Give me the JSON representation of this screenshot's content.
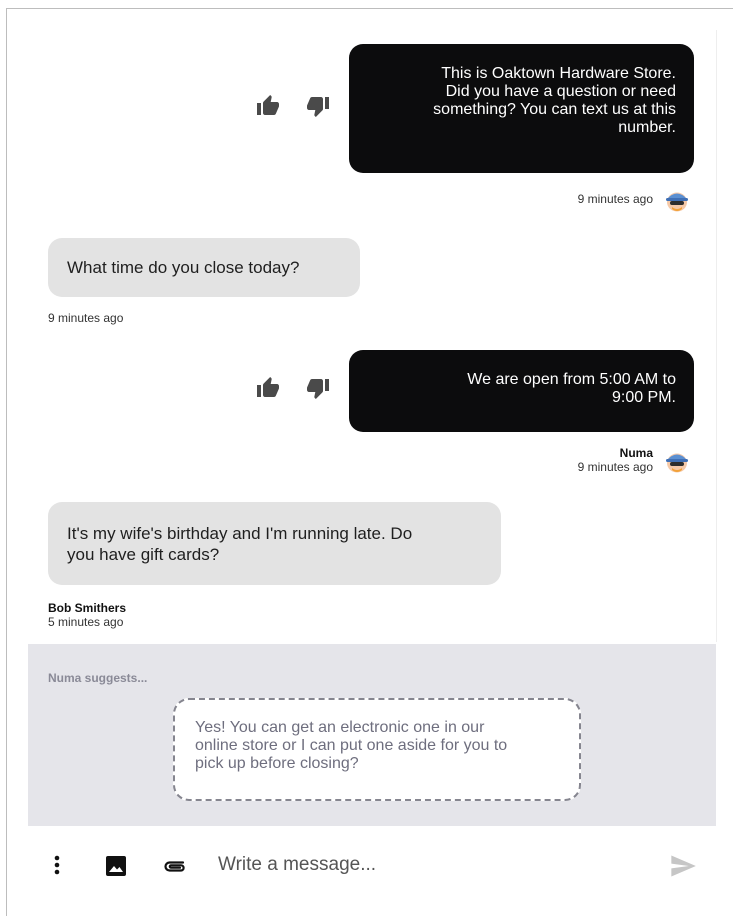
{
  "conversation": {
    "messages": [
      {
        "direction": "outgoing",
        "lines": [
          "This is Oaktown Hardware Store.",
          "Did you have a question or need",
          "something? You can text us at this",
          "number."
        ],
        "sender": "",
        "time": "9 minutes ago"
      },
      {
        "direction": "incoming",
        "lines": [
          "What time do you close today?"
        ],
        "sender": "",
        "time": "9 minutes ago"
      },
      {
        "direction": "outgoing",
        "lines": [
          "We are open from 5:00 AM to",
          "9:00 PM."
        ],
        "sender": "Numa",
        "time": "9 minutes ago"
      },
      {
        "direction": "incoming",
        "lines": [
          "It's my wife's birthday and I'm running late. Do",
          "you have gift cards?"
        ],
        "sender": "Bob Smithers",
        "time": "5 minutes ago"
      }
    ]
  },
  "suggestion": {
    "label": "Numa suggests...",
    "lines": [
      "Yes!  You can get an electronic one in our",
      "online store or I can put one aside for you to",
      "pick up before closing?"
    ]
  },
  "composer": {
    "placeholder": "Write a message...",
    "icons": [
      "more-vertical-icon",
      "image-icon",
      "paperclip-icon",
      "send-icon"
    ]
  },
  "icons": {
    "thumbs_up": "thumbs-up-icon",
    "thumbs_down": "thumbs-down-icon",
    "avatar": "bot-avatar-icon"
  },
  "colors": {
    "outgoing_bubble": "#0c0c0d",
    "incoming_bubble": "#e3e3e3",
    "suggest_panel": "#e5e5ea",
    "icon_gray": "#4a4a4a"
  }
}
